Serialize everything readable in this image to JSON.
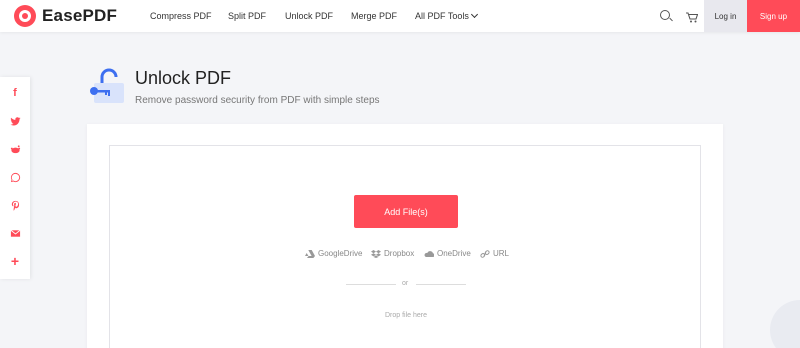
{
  "brand": {
    "name": "EasePDF",
    "accent": "#ff4b58"
  },
  "nav": {
    "items": [
      "Compress PDF",
      "Split PDF",
      "Unlock PDF",
      "Merge PDF",
      "All PDF Tools"
    ]
  },
  "header": {
    "login_label": "Log in",
    "signup_label": "Sign up"
  },
  "social": [
    "facebook-icon",
    "twitter-icon",
    "reddit-icon",
    "whatsapp-icon",
    "pinterest-icon",
    "email-icon",
    "plus-icon"
  ],
  "page": {
    "title": "Unlock PDF",
    "subtitle": "Remove password security from PDF with simple steps"
  },
  "upload": {
    "add_label": "Add File(s)",
    "sources": [
      "GoogleDrive",
      "Dropbox",
      "OneDrive",
      "URL"
    ],
    "or_label": "or",
    "drop_label": "Drop file here"
  }
}
